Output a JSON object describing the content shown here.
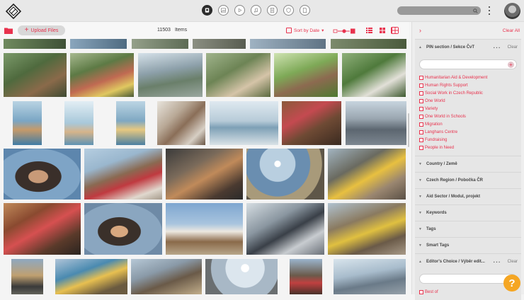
{
  "toolbar": {
    "upload_label": "Upload Files",
    "count_value": "11503",
    "count_label": "Items",
    "sort_label": "Sort by Date"
  },
  "icons": {
    "nav": [
      "dashboard-icon",
      "image-icon",
      "video-icon",
      "audio-icon",
      "document-icon",
      "shield-icon",
      "file-icon"
    ],
    "views": [
      "list-view-icon",
      "small-grid-icon",
      "large-grid-icon"
    ]
  },
  "colors": {
    "accent": "#e8324d",
    "help": "#f5a623"
  },
  "panel": {
    "clear_all": "Clear All",
    "sections": [
      {
        "title": "PIN section / Sekce ČvT",
        "expanded": true,
        "clear": "Clear",
        "options": [
          "Humanitarian Aid & Development",
          "Human Rights Support",
          "Social Work in Czech Republic",
          "One World",
          "Variety",
          "One World in Schools",
          "Migration",
          "Langhans Centre",
          "Fundraising",
          "People in Need"
        ]
      },
      {
        "title": "Country / Země",
        "expanded": false
      },
      {
        "title": "Czech Region / Pobočka ČR",
        "expanded": false
      },
      {
        "title": "Aid Sector / Modul, projekt",
        "expanded": false
      },
      {
        "title": "Keywords",
        "expanded": false
      },
      {
        "title": "Tags",
        "expanded": false
      },
      {
        "title": "Smart Tags",
        "expanded": false
      },
      {
        "title": "Editor's Choice / Výběr edit...",
        "expanded": true,
        "clear": "Clear",
        "options": [
          "Best of"
        ]
      }
    ]
  },
  "help_label": "?"
}
